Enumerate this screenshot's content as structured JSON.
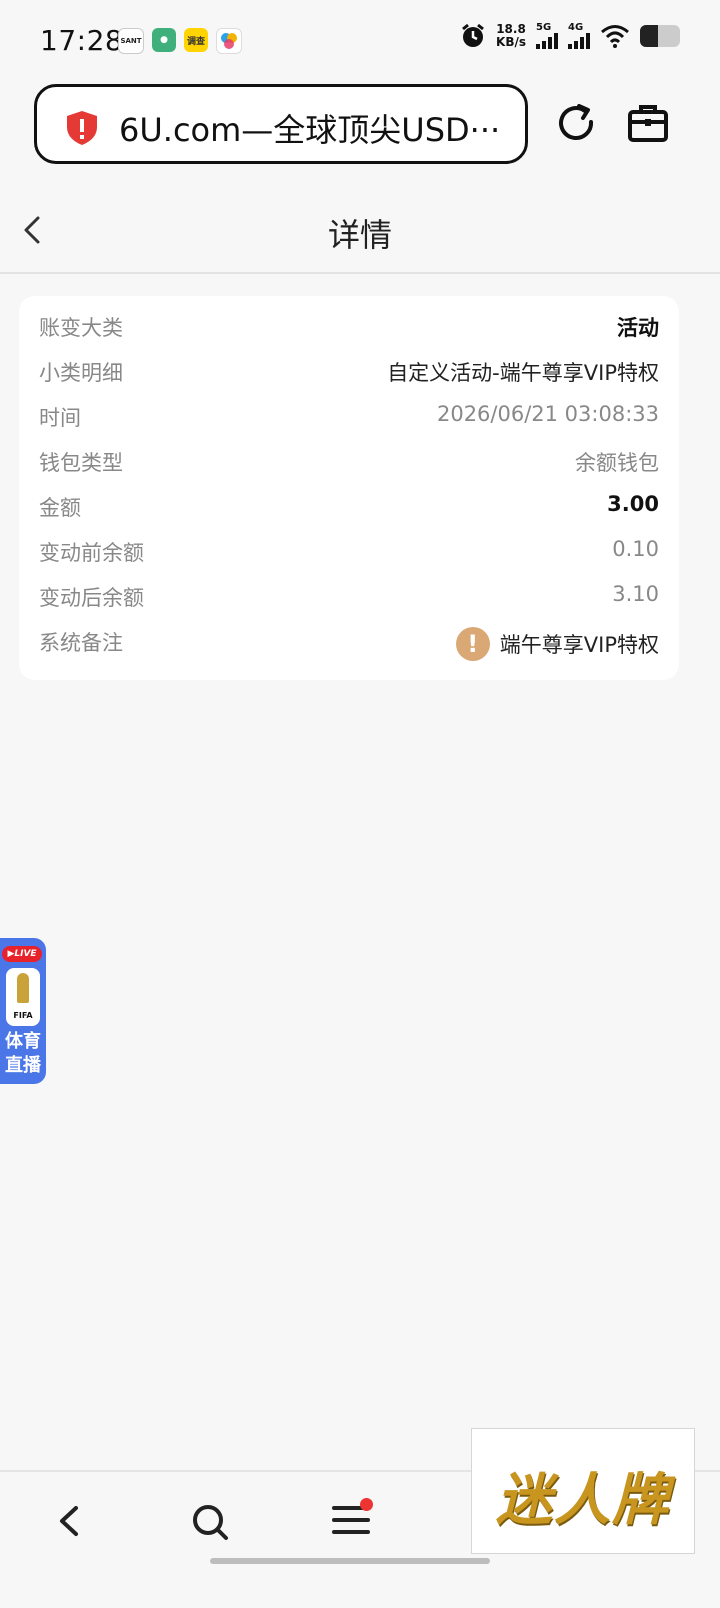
{
  "status_bar": {
    "time": "17:28",
    "app_icons": [
      "SANT",
      "",
      "调查",
      ""
    ],
    "net_speed_value": "18.8",
    "net_speed_unit": "KB/s",
    "signal_1": "5G",
    "signal_2": "4G",
    "battery_level": 0.45
  },
  "browser": {
    "address_text": "6U.com—全球顶尖USD···"
  },
  "header": {
    "title": "详情"
  },
  "detail": {
    "rows": [
      {
        "label": "账变大类",
        "value": "活动"
      },
      {
        "label": "小类明细",
        "value": "自定义活动-端午尊享VIP特权"
      },
      {
        "label": "时间",
        "value": "2026/06/21 03:08:33"
      },
      {
        "label": "钱包类型",
        "value": "余额钱包"
      },
      {
        "label": "金额",
        "value": "3.00"
      },
      {
        "label": "变动前余额",
        "value": "0.10"
      },
      {
        "label": "变动后余额",
        "value": "3.10"
      },
      {
        "label": "系统备注",
        "value": "端午尊享VIP特权"
      }
    ],
    "warn_glyph": "!"
  },
  "live_widget": {
    "tag": "▶LIVE",
    "fifa": "FIFA",
    "line1": "体育",
    "line2": "直播"
  },
  "ad": {
    "text": "迷人牌"
  },
  "colors": {
    "accent_warn": "#d9a874",
    "live_blue": "#4a76e8",
    "notification_red": "#ee3333"
  }
}
